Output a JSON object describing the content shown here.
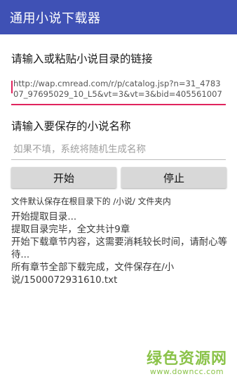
{
  "app": {
    "title": "通用小说下载器"
  },
  "url_section": {
    "label": "请输入或粘贴小说目录的链接",
    "value": "http://wap.cmread.com/r/p/catalog.jsp?n=31_478307_97695029_10_L5&vt=3&vt=3&bid=405561007"
  },
  "name_section": {
    "label": "请输入要保存的小说名称",
    "placeholder": "如果不填，系统将随机生成名称",
    "value": ""
  },
  "buttons": {
    "start": "开始",
    "stop": "停止"
  },
  "save_note": "文件默认保存在根目录下的 /小说/ 文件夹内",
  "log": [
    "开始提取目录...",
    "提取目录完毕，全文共计9章",
    "开始下载章节内容，这需要消耗较长时间，请耐心等待...",
    "所有章节全部下载完成，文件保存在/小说/1500072931610.txt"
  ],
  "watermark": {
    "title": "绿色资源网",
    "url": "www.downcc.com"
  },
  "colors": {
    "appbar": "#3f51b5",
    "focus_underline": "#e0245e",
    "watermark": "#8bc34a"
  }
}
